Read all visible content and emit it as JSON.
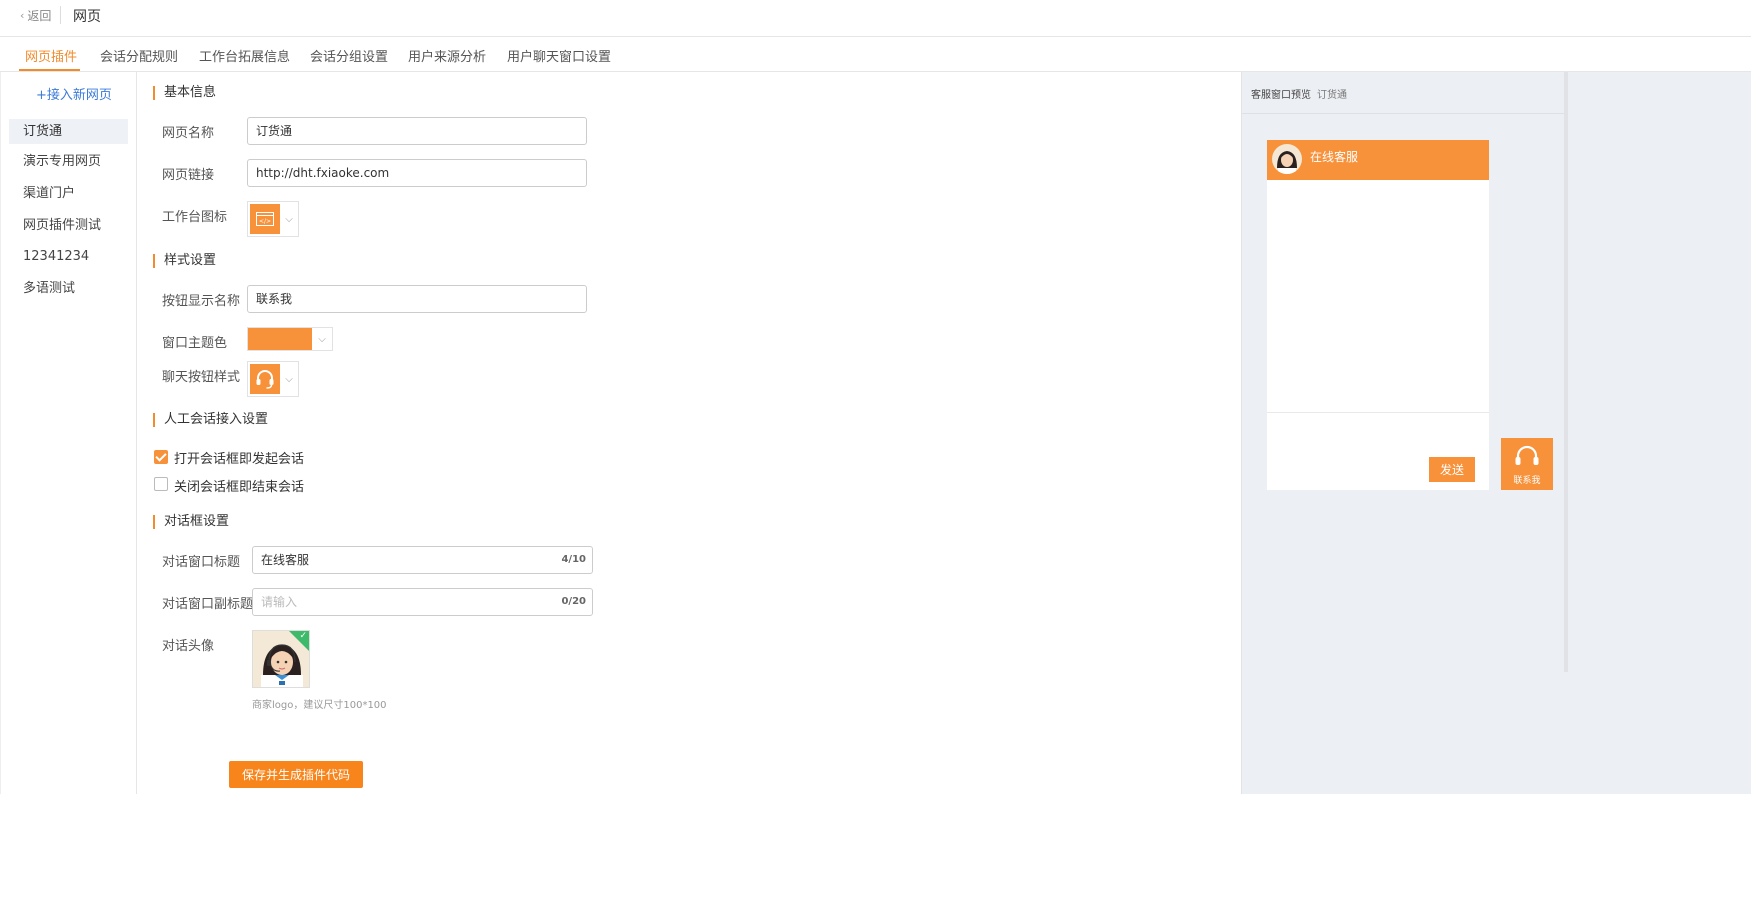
{
  "topbar": {
    "back_label": "返回",
    "title": "网页"
  },
  "tabs": [
    {
      "label": "网页插件"
    },
    {
      "label": "会话分配规则"
    },
    {
      "label": "工作台拓展信息"
    },
    {
      "label": "会话分组设置"
    },
    {
      "label": "用户来源分析"
    },
    {
      "label": "用户聊天窗口设置"
    }
  ],
  "sidebar": {
    "add_label": "+接入新网页",
    "items": [
      {
        "label": "订货通"
      },
      {
        "label": "演示专用网页"
      },
      {
        "label": "渠道门户"
      },
      {
        "label": "网页插件测试"
      },
      {
        "label": "12341234"
      },
      {
        "label": "多语测试"
      }
    ]
  },
  "form": {
    "basic": {
      "heading": "基本信息",
      "name_label": "网页名称",
      "name_value": "订货通",
      "url_label": "网页链接",
      "url_value": "http://dht.fxiaoke.com",
      "icon_label": "工作台图标"
    },
    "style": {
      "heading": "样式设置",
      "button_name_label": "按钮显示名称",
      "button_name_value": "联系我",
      "theme_label": "窗口主题色",
      "theme_color": "#f7913a",
      "chat_btn_label": "聊天按钮样式"
    },
    "manual": {
      "heading": "人工会话接入设置",
      "open_label": "打开会话框即发起会话",
      "open_checked": true,
      "close_label": "关闭会话框即结束会话",
      "close_checked": false
    },
    "dialog": {
      "heading": "对话框设置",
      "title_label": "对话窗口标题",
      "title_value": "在线客服",
      "title_count": "4/10",
      "subtitle_label": "对话窗口副标题",
      "subtitle_placeholder": "请输入",
      "subtitle_count": "0/20",
      "avatar_label": "对话头像",
      "avatar_hint": "商家logo，建议尺寸100*100"
    },
    "save_label": "保存并生成插件代码"
  },
  "preview": {
    "title": "客服窗口预览",
    "name": "订货通",
    "chat_title": "在线客服",
    "send_label": "发送",
    "contact_label": "联系我"
  }
}
